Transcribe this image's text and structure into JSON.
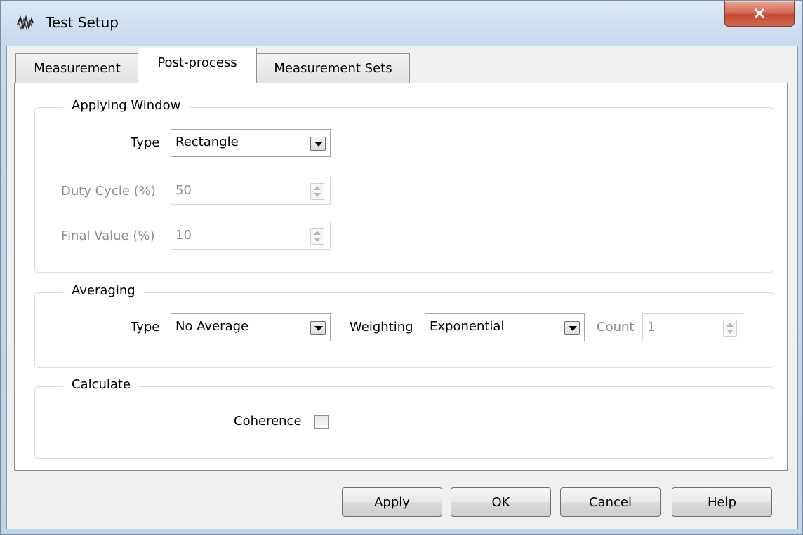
{
  "window": {
    "title": "Test Setup",
    "close_label": "x"
  },
  "tabs": [
    {
      "label": "Measurement",
      "active": false
    },
    {
      "label": "Post-process",
      "active": true
    },
    {
      "label": "Measurement Sets",
      "active": false
    }
  ],
  "applying_window": {
    "title": "Applying Window",
    "type_label": "Type",
    "type_value": "Rectangle",
    "duty_cycle_label": "Duty Cycle (%)",
    "duty_cycle_value": "50",
    "final_value_label": "Final Value (%)",
    "final_value_value": "10"
  },
  "averaging": {
    "title": "Averaging",
    "type_label": "Type",
    "type_value": "No Average",
    "weighting_label": "Weighting",
    "weighting_value": "Exponential",
    "count_label": "Count",
    "count_value": "1"
  },
  "calculate": {
    "title": "Calculate",
    "coherence_label": "Coherence",
    "coherence_checked": false
  },
  "buttons": {
    "apply": "Apply",
    "ok": "OK",
    "cancel": "Cancel",
    "help": "Help"
  },
  "icons": {
    "app": "signal-waves-icon",
    "close": "close-icon"
  },
  "colors": {
    "close_button": "#c94a32",
    "disabled_text": "#8d8d8d",
    "group_border": "#d5dfe5"
  }
}
